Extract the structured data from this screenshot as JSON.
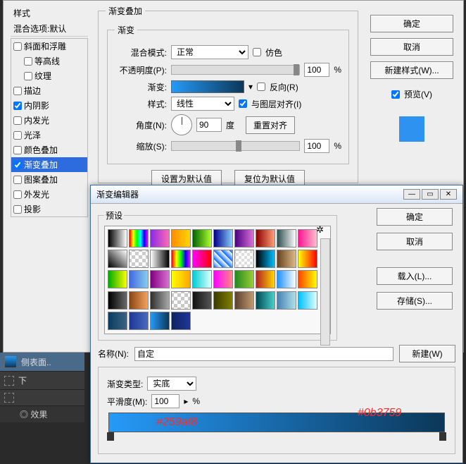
{
  "styles_header": "样式",
  "blend_header": "混合选项:默认",
  "style_items": [
    {
      "label": "斜面和浮雕",
      "checked": false,
      "indent": false
    },
    {
      "label": "等高线",
      "checked": false,
      "indent": true
    },
    {
      "label": "纹理",
      "checked": false,
      "indent": true
    },
    {
      "label": "描边",
      "checked": false,
      "indent": false
    },
    {
      "label": "内阴影",
      "checked": true,
      "indent": false
    },
    {
      "label": "内发光",
      "checked": false,
      "indent": false
    },
    {
      "label": "光泽",
      "checked": false,
      "indent": false
    },
    {
      "label": "颜色叠加",
      "checked": false,
      "indent": false
    },
    {
      "label": "渐变叠加",
      "checked": true,
      "indent": false,
      "selected": true
    },
    {
      "label": "图案叠加",
      "checked": false,
      "indent": false
    },
    {
      "label": "外发光",
      "checked": false,
      "indent": false
    },
    {
      "label": "投影",
      "checked": false,
      "indent": false
    }
  ],
  "grad_group_title": "渐变叠加",
  "inner_title": "渐变",
  "blend_mode": {
    "label": "混合模式:",
    "value": "正常",
    "dither": "仿色"
  },
  "opacity": {
    "label": "不透明度(P):",
    "value": "100",
    "unit": "%"
  },
  "gradient": {
    "label": "渐变:",
    "reverse": "反向(R)"
  },
  "style": {
    "label": "样式:",
    "value": "线性",
    "align": "与图层对齐(I)"
  },
  "angle": {
    "label": "角度(N):",
    "value": "90",
    "unit": "度",
    "reset": "重置对齐"
  },
  "scale": {
    "label": "缩放(S):",
    "value": "100",
    "unit": "%"
  },
  "set_default": "设置为默认值",
  "reset_default": "复位为默认值",
  "right": {
    "ok": "确定",
    "cancel": "取消",
    "newstyle": "新建样式(W)...",
    "preview": "预览(V)"
  },
  "editor": {
    "title": "渐变编辑器",
    "presets": "预设",
    "ok": "确定",
    "cancel": "取消",
    "load": "载入(L)...",
    "save": "存储(S)...",
    "name_label": "名称(N):",
    "name_value": "自定",
    "new": "新建(W)",
    "type_label": "渐变类型:",
    "type_value": "实底",
    "smooth_label": "平滑度(M):",
    "smooth_value": "100",
    "smooth_unit": "%"
  },
  "annotations": {
    "a": "#259af8",
    "b": "#0b3759"
  },
  "layers": {
    "surface": "侧表面..",
    "down": "下",
    "fx": "效果"
  },
  "swatches": [
    "linear-gradient(90deg,#000,#fff)",
    "linear-gradient(90deg,#ff0000,#ffff00,#00ff00,#00ffff,#0000ff,#ff00ff)",
    "linear-gradient(90deg,#8a2be2,#ff69b4)",
    "linear-gradient(90deg,#ff8c00,#ffd700)",
    "linear-gradient(90deg,#006400,#adff2f)",
    "linear-gradient(90deg,#00008b,#87cefa)",
    "linear-gradient(90deg,#4b0082,#da70d6)",
    "linear-gradient(90deg,#8b0000,#ffa07a)",
    "linear-gradient(90deg,#2f4f4f,#ffffff)",
    "linear-gradient(90deg,#ff1493,#ffc0cb)",
    "linear-gradient(45deg,#000,#fff)",
    "repeating-conic-gradient(#ccc 0 25%,#fff 0 50%) 50%/10px 10px",
    "linear-gradient(90deg,#fff,#000)",
    "linear-gradient(90deg,#ff0000,#ffff00,#00ff00,#0000ff,#ff00ff)",
    "linear-gradient(90deg,#ff00ff,#ff0000)",
    "repeating-linear-gradient(45deg,#06f,#fff 8px)",
    "repeating-conic-gradient(#ddd 0 25%,#fff 0 50%) 50%/8px 8px",
    "linear-gradient(90deg,#000,#00bfff)",
    "linear-gradient(90deg,#654321,#deb887)",
    "linear-gradient(90deg,#ff0,#f00)",
    "linear-gradient(90deg,#0a0,#ff0)",
    "linear-gradient(90deg,#4169e1,#87ceeb)",
    "linear-gradient(90deg,#800080,#da70d6)",
    "linear-gradient(90deg,#ff0,#ffa500)",
    "linear-gradient(90deg,#00ced1,#e0ffff)",
    "linear-gradient(90deg,#f0f,#f88)",
    "linear-gradient(90deg,#228b22,#9acd32)",
    "linear-gradient(90deg,#b22222,#ffd700)",
    "linear-gradient(90deg,#1e90ff,#fff)",
    "linear-gradient(90deg,#ff4500,#ffff00)",
    "linear-gradient(90deg,#000,#696969)",
    "linear-gradient(90deg,#8b4513,#f4a460)",
    "linear-gradient(90deg,#2f2f2f,#a9a9a9)",
    "repeating-conic-gradient(#c8c8c8 0 25%,#fff 0 50%) 50%/10px 10px",
    "linear-gradient(90deg,#111,#555)",
    "linear-gradient(90deg,#3b3b00,#808000)",
    "linear-gradient(90deg,#5c4033,#c19a6b)",
    "linear-gradient(90deg,#004953,#48d1cc)",
    "linear-gradient(90deg,#4682b4,#b0e0e6)",
    "linear-gradient(90deg,#00bfff,#e0ffff)",
    "linear-gradient(90deg,#0a3d62,#3c6382)",
    "linear-gradient(90deg,#1e3799,#4a69bd)",
    "linear-gradient(90deg,#259af8,#0b3759)",
    "linear-gradient(90deg,#0c2461,#1e3799)",
    "",
    "",
    "",
    "",
    "",
    ""
  ]
}
